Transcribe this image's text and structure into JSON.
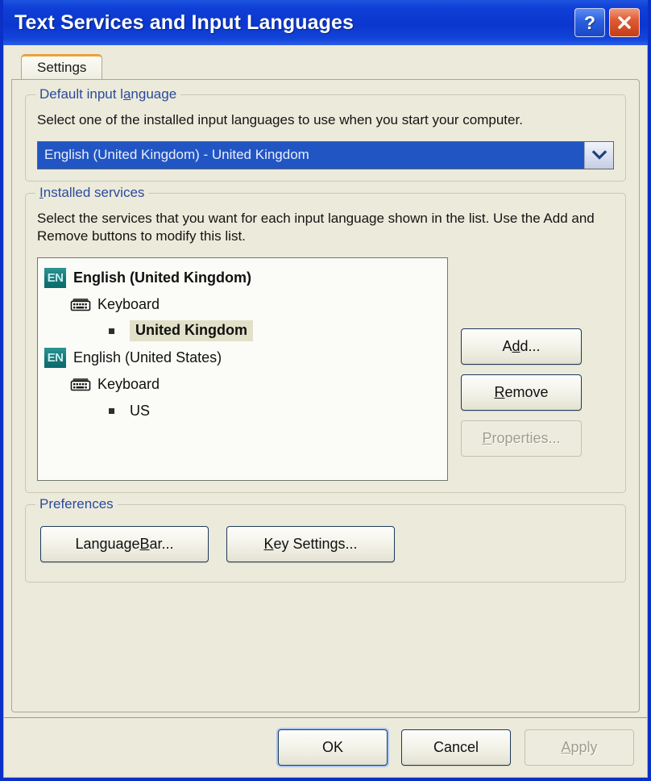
{
  "window": {
    "title": "Text Services and Input Languages",
    "help_button": "?",
    "close_button": "✕"
  },
  "tabs": [
    {
      "label": "Settings",
      "active": true
    }
  ],
  "default_input_language": {
    "group_label": "Default input language",
    "group_label_pre": "Default input l",
    "group_label_acc": "a",
    "group_label_post": "nguage",
    "description": "Select one of the installed input languages to use when you start your computer.",
    "combo": {
      "value": "English (United Kingdom) - United Kingdom",
      "arrow_icon": "chevron-down-icon",
      "selected": true
    }
  },
  "installed_services": {
    "group_label_pre": "",
    "group_label_acc": "I",
    "group_label_post": "nstalled services",
    "description": "Select the services that you want for each input language shown in the list. Use the Add and Remove buttons to modify this list.",
    "tree": [
      {
        "type": "language",
        "icon": "en-badge-icon",
        "icon_text": "EN",
        "label": "English (United Kingdom)",
        "bold": true,
        "selected": false
      },
      {
        "type": "category",
        "icon": "keyboard-icon",
        "label": "Keyboard",
        "bold": false,
        "selected": false
      },
      {
        "type": "leaf",
        "icon": "bullet-icon",
        "label": "United Kingdom",
        "bold": true,
        "selected": true
      },
      {
        "type": "language",
        "icon": "en-badge-icon",
        "icon_text": "EN",
        "label": "English (United States)",
        "bold": false,
        "selected": false
      },
      {
        "type": "category",
        "icon": "keyboard-icon",
        "label": "Keyboard",
        "bold": false,
        "selected": false
      },
      {
        "type": "leaf",
        "icon": "bullet-icon",
        "label": "US",
        "bold": false,
        "selected": false
      }
    ],
    "buttons": [
      {
        "pre": "A",
        "acc": "d",
        "post": "d...",
        "plain": "Add...",
        "enabled": true
      },
      {
        "pre": "",
        "acc": "R",
        "post": "emove",
        "plain": "Remove",
        "enabled": true
      },
      {
        "pre": "",
        "acc": "P",
        "post": "roperties...",
        "plain": "Properties...",
        "enabled": false
      }
    ]
  },
  "preferences": {
    "group_label": "Preferences",
    "buttons": [
      {
        "pre": "Language ",
        "acc": "B",
        "post": "ar...",
        "plain": "Language Bar...",
        "enabled": true
      },
      {
        "pre": "",
        "acc": "K",
        "post": "ey Settings...",
        "plain": "Key Settings...",
        "enabled": true
      }
    ]
  },
  "dialog_buttons": [
    {
      "pre": "",
      "acc": "",
      "post": "OK",
      "plain": "OK",
      "enabled": true,
      "default": true
    },
    {
      "pre": "",
      "acc": "",
      "post": "Cancel",
      "plain": "Cancel",
      "enabled": true,
      "default": false
    },
    {
      "pre": "",
      "acc": "A",
      "post": "pply",
      "plain": "Apply",
      "enabled": false,
      "default": false
    }
  ],
  "colors": {
    "titlebar_blue": "#0b37cf",
    "dialog_background": "#eceadb",
    "group_label_blue": "#2a4b9b",
    "combo_selection_blue": "#2255c4",
    "en_badge_teal": "#157a7a",
    "tab_accent_orange": "#e8a33d",
    "tree_selection_khaki": "#e2e0c8",
    "close_button_red": "#c23d18"
  }
}
